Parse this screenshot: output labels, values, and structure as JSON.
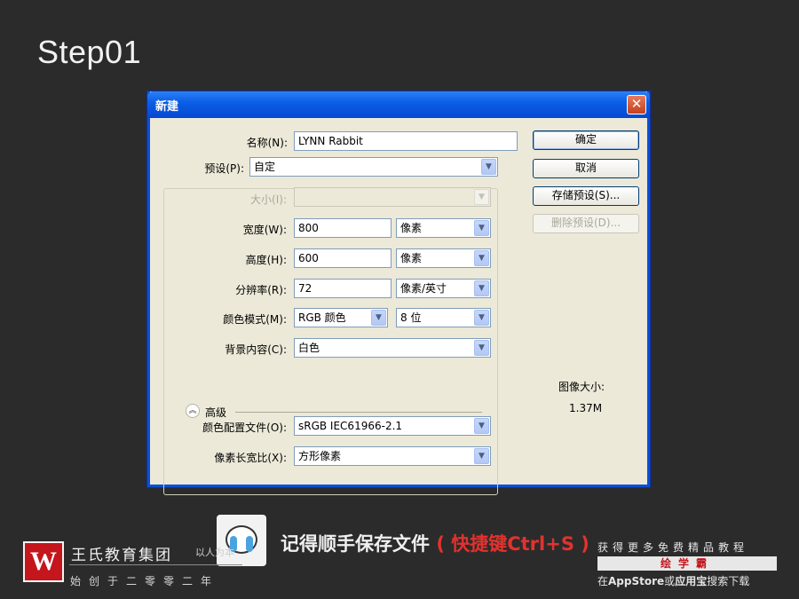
{
  "step_title": "Step01",
  "dialog": {
    "title": "新建",
    "close_glyph": "✕",
    "fields": {
      "name": {
        "label": "名称(N):",
        "value": "LYNN Rabbit"
      },
      "preset": {
        "label": "预设(P):",
        "value": "自定"
      },
      "size": {
        "label": "大小(I):",
        "value": ""
      },
      "width": {
        "label": "宽度(W):",
        "value": "800",
        "unit": "像素"
      },
      "height": {
        "label": "高度(H):",
        "value": "600",
        "unit": "像素"
      },
      "resolution": {
        "label": "分辨率(R):",
        "value": "72",
        "unit": "像素/英寸"
      },
      "color_mode": {
        "label": "颜色模式(M):",
        "value": "RGB 颜色",
        "depth": "8 位"
      },
      "background": {
        "label": "背景内容(C):",
        "value": "白色"
      },
      "color_profile": {
        "label": "颜色配置文件(O):",
        "value": "sRGB IEC61966-2.1"
      },
      "pixel_aspect": {
        "label": "像素长宽比(X):",
        "value": "方形像素"
      }
    },
    "advanced_label": "高级",
    "buttons": {
      "ok": "确定",
      "cancel": "取消",
      "save_preset": "存储预设(S)...",
      "delete_preset": "删除预设(D)..."
    },
    "image_size_label": "图像大小:",
    "image_size_value": "1.37M"
  },
  "banner": {
    "reminder_text": "记得顺手保存文件",
    "reminder_shortcut": "( 快捷键Ctrl+S )",
    "logo_letter": "W",
    "brand_name": "王氏教育集团",
    "slogan": "以人为本",
    "founded": "始创于二零零二年",
    "promo_top": "获得更多免费精品教程",
    "promo_bar": "绘学霸",
    "promo_bottom_prefix": "在",
    "promo_bottom_appstore": "AppStore",
    "promo_bottom_mid": "或",
    "promo_bottom_yyb": "应用宝",
    "promo_bottom_suffix": "搜索下载"
  },
  "colors": {
    "background": "#2b2b2b",
    "titlebar": "#0b5fe6",
    "dialog_face": "#ece9d8",
    "accent_red": "#e3322e"
  }
}
